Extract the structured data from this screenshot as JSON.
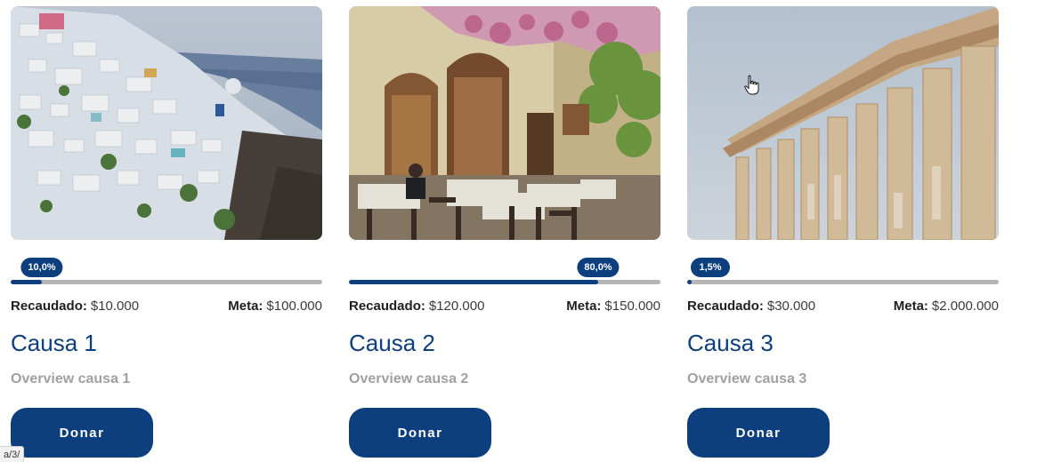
{
  "causes": [
    {
      "image_name": "santorini-village-photo",
      "progress_percent": 10.0,
      "progress_label": "10,0%",
      "raised_label": "Recaudado:",
      "raised_value": "$10.000",
      "goal_label": "Meta:",
      "goal_value": "$100.000",
      "title": "Causa 1",
      "overview": "Overview causa 1",
      "donate_label": "Donar"
    },
    {
      "image_name": "greek-taverna-street-photo",
      "progress_percent": 80.0,
      "progress_label": "80,0%",
      "raised_label": "Recaudado:",
      "raised_value": "$120.000",
      "goal_label": "Meta:",
      "goal_value": "$150.000",
      "title": "Causa 2",
      "overview": "Overview causa 2",
      "donate_label": "Donar"
    },
    {
      "image_name": "parthenon-columns-photo",
      "progress_percent": 1.5,
      "progress_label": "1,5%",
      "raised_label": "Recaudado:",
      "raised_value": "$30.000",
      "goal_label": "Meta:",
      "goal_value": "$2.000.000",
      "title": "Causa 3",
      "overview": "Overview causa 3",
      "donate_label": "Donar"
    }
  ],
  "status_bar": {
    "url_fragment": "a/3/"
  },
  "colors": {
    "primary": "#0d3f7e",
    "track": "#b5b5b5",
    "muted_text": "#a0a0a0"
  },
  "cursor_icon": "hand-pointer-icon"
}
